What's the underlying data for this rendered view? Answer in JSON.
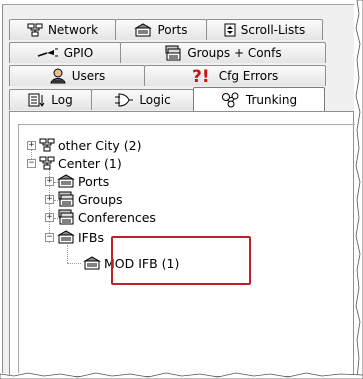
{
  "tabs": {
    "row1": [
      {
        "label": "Network",
        "icon": "network-icon"
      },
      {
        "label": "Ports",
        "icon": "ports-icon"
      },
      {
        "label": "Scroll-Lists",
        "icon": "scroll-lists-icon"
      }
    ],
    "row2": [
      {
        "label": "GPIO",
        "icon": "gpio-icon"
      },
      {
        "label": "Groups + Confs",
        "icon": "groups-icon"
      }
    ],
    "row3": [
      {
        "label": "Users",
        "icon": "users-icon"
      },
      {
        "label": "Cfg Errors",
        "icon": "cfg-errors-icon"
      }
    ],
    "row4": [
      {
        "label": "Log",
        "icon": "log-icon"
      },
      {
        "label": "Logic",
        "icon": "logic-icon"
      },
      {
        "label": "Trunking",
        "icon": "trunking-icon",
        "selected": true
      }
    ]
  },
  "tree": {
    "nodes": [
      {
        "label": "other City (2)",
        "icon": "network-icon",
        "expander": "+"
      },
      {
        "label": "Center (1)",
        "icon": "network-icon",
        "expander": "−"
      },
      {
        "label": "Ports",
        "icon": "ports-icon",
        "expander": "+"
      },
      {
        "label": "Groups",
        "icon": "groups-icon",
        "expander": "+"
      },
      {
        "label": "Conferences",
        "icon": "groups-icon",
        "expander": "+"
      },
      {
        "label": "IFBs",
        "icon": "ports-icon",
        "expander": "−"
      },
      {
        "label": "MOD IFB (1)",
        "icon": "ports-icon",
        "expander": ""
      }
    ]
  },
  "colors": {
    "highlight": "#c0202a",
    "error": "#d01010"
  }
}
